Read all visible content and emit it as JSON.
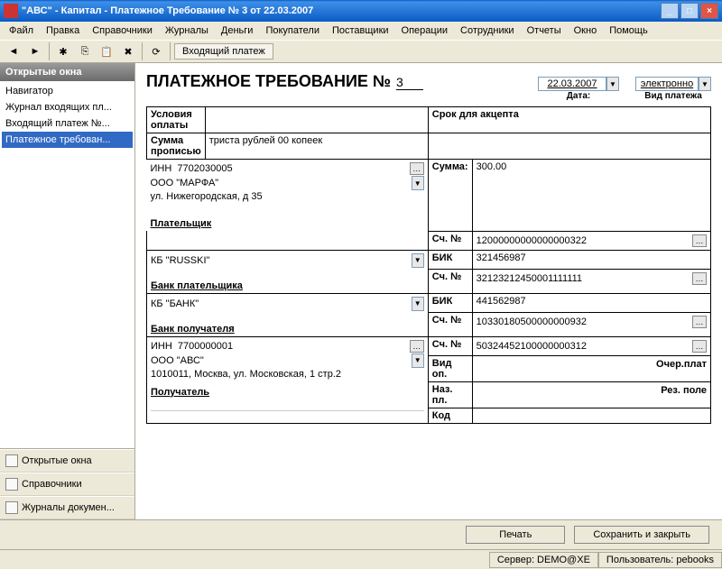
{
  "window": {
    "title": "\"АВС\" - Капитал - Платежное Требование № 3 от 22.03.2007"
  },
  "menu": [
    "Файл",
    "Правка",
    "Справочники",
    "Журналы",
    "Деньги",
    "Покупатели",
    "Поставщики",
    "Операции",
    "Сотрудники",
    "Отчеты",
    "Окно",
    "Помощь"
  ],
  "breadcrumb": "Входящий платеж",
  "sidebar": {
    "header": "Открытые окна",
    "items": [
      "Навигатор",
      "Журнал входящих пл...",
      "Входящий платеж №...",
      "Платежное требован..."
    ],
    "selectedIndex": 3,
    "nav": [
      "Открытые окна",
      "Справочники",
      "Журналы докумен..."
    ]
  },
  "doc": {
    "title": "ПЛАТЕЖНОЕ ТРЕБОВАНИЕ №",
    "num": "3",
    "date": "22.03.2007",
    "date_label": "Дата:",
    "pay_type": "электронно",
    "pay_type_label": "Вид платежа",
    "cond_label": "Условия оплаты",
    "accept_label": "Срок для акцепта",
    "sum_words_label": "Сумма прописью",
    "sum_words": "триста рублей 00 копеек",
    "inn_label": "ИНН",
    "payer_inn": "7702030005",
    "payer_name": "ООО \"МАРФА\"",
    "payer_addr": "ул. Нижегородская, д 35",
    "sum_label": "Сумма:",
    "sum": "300.00",
    "acc_label": "Сч. №",
    "payer_acc": "12000000000000000322",
    "payer_section": "Плательщик",
    "payer_bank": "КБ \"RUSSKI\"",
    "bik_label": "БИК",
    "payer_bik": "321456987",
    "payer_bank_acc": "32123212450001111111",
    "payer_bank_section": "Банк плательщика",
    "recv_bank": "КБ \"БАНК\"",
    "recv_bik": "441562987",
    "recv_bank_acc": "10330180500000000932",
    "recv_bank_section": "Банк получателя",
    "recv_inn": "7700000001",
    "recv_name": "ООО \"АВС\"",
    "recv_addr": "1010011, Москва, ул. Московская, 1 стр.2",
    "recv_acc": "50324452100000000312",
    "recv_section": "Получатель",
    "vid_op": "Вид оп.",
    "naz_pl": "Наз. пл.",
    "kod": "Код",
    "ocher": "Очер.плат",
    "rez": "Рез. поле"
  },
  "buttons": {
    "print": "Печать",
    "save": "Сохранить и закрыть"
  },
  "status": {
    "server": "Сервер: DEMO@XE",
    "user": "Пользователь: pebooks"
  }
}
